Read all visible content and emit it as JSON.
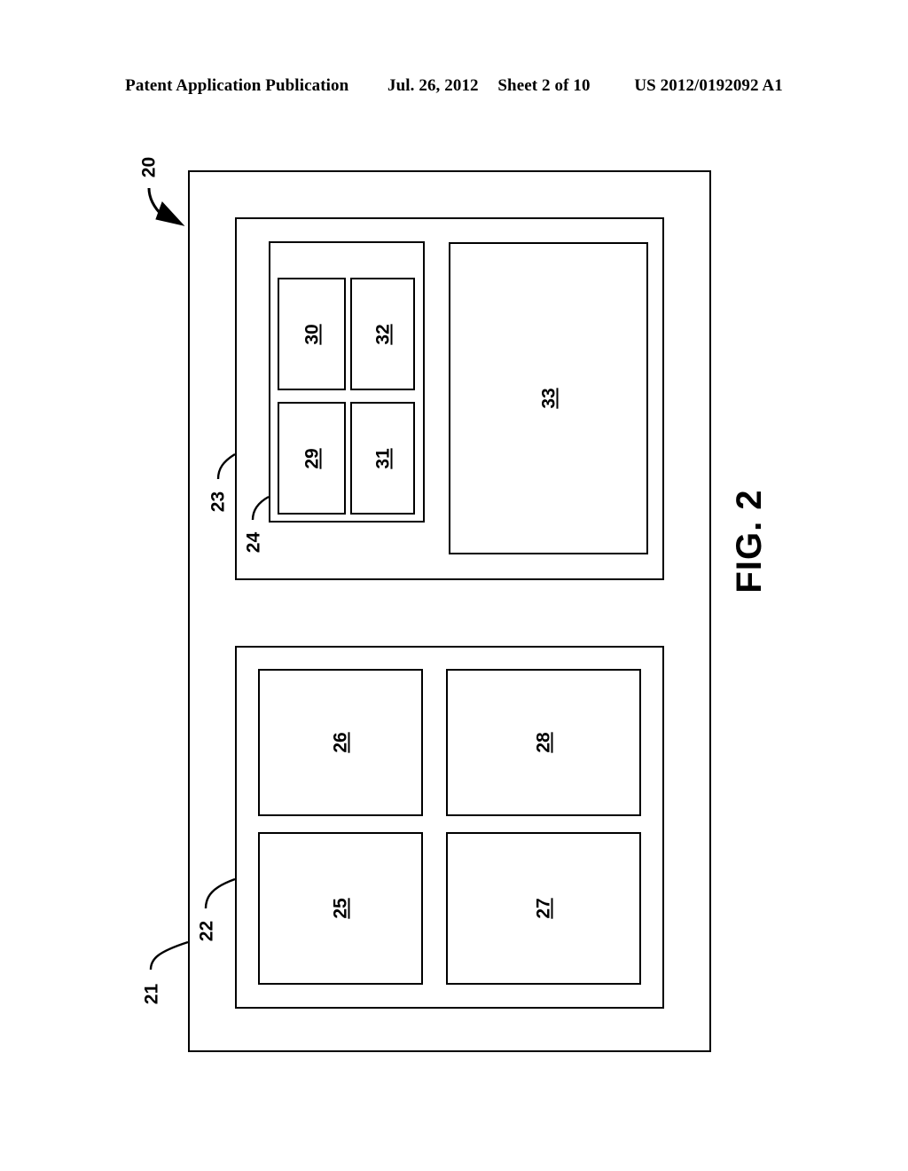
{
  "header": {
    "publication": "Patent Application Publication",
    "date": "Jul. 26, 2012",
    "sheet": "Sheet 2 of 10",
    "docnum": "US 2012/0192092 A1"
  },
  "figure": {
    "caption": "FIG. 2",
    "ink_color": "#000000",
    "paper_color": "#ffffff"
  },
  "callouts": {
    "system": "20",
    "outer_enclosure": "21",
    "lower_assembly": "22",
    "upper_assembly": "23",
    "upper_subassembly": "24"
  },
  "blocks": {
    "b25": "25",
    "b26": "26",
    "b27": "27",
    "b28": "28",
    "b29": "29",
    "b30": "30",
    "b31": "31",
    "b32": "32",
    "b33": "33"
  }
}
